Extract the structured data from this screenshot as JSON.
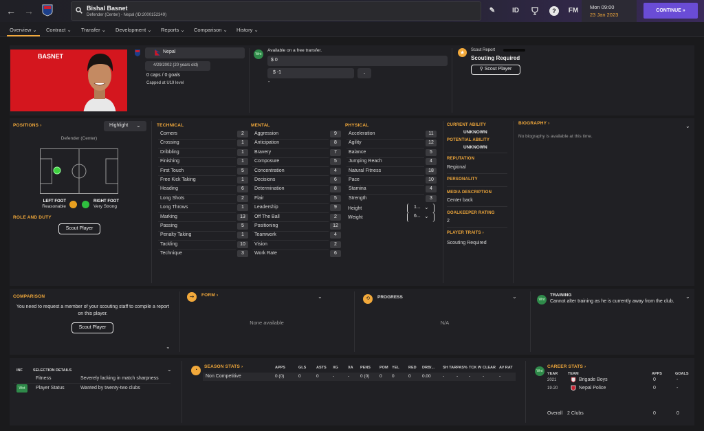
{
  "topbar": {
    "player_name": "Bishal Basnet",
    "player_sub": "Defender (Center) - Nepal (ID:2000152349)",
    "tools": {
      "edit": "✎",
      "id": "ID",
      "fm": "FM",
      "help": "?"
    },
    "date_day": "Mon 09:00",
    "date": "23 Jan 2023",
    "continue_label": "CONTINUE"
  },
  "menu": [
    "Overview",
    "Contract",
    "Transfer",
    "Development",
    "Reports",
    "Comparison",
    "History"
  ],
  "header": {
    "surname": "BASNET",
    "nation": "Nepal",
    "dob": "4/29/2002 (20 years old)",
    "caps": "0 caps / 0 goals",
    "capped": "Capped at U19 level",
    "transfer_status": "Available on a free transfer.",
    "value": "$ 0",
    "wage": "$ -1",
    "wage_dash": "-",
    "extra": "-",
    "scout_report_label": "Scout Report",
    "scouting_required": "Scouting Required",
    "scout_button": "Scout Player",
    "wnt_badge": "Wnt"
  },
  "positions": {
    "title": "POSITIONS",
    "highlight": "Highlight",
    "position": "Defender (Center)",
    "left_foot_label": "LEFT FOOT",
    "left_foot": "Reasonable",
    "right_foot_label": "RIGHT FOOT",
    "right_foot": "Very Strong",
    "role_title": "ROLE AND DUTY",
    "scout_button": "Scout Player"
  },
  "technical": {
    "title": "TECHNICAL",
    "items": [
      {
        "l": "Corners",
        "v": "2"
      },
      {
        "l": "Crossing",
        "v": "1"
      },
      {
        "l": "Dribbling",
        "v": "1"
      },
      {
        "l": "Finishing",
        "v": "1"
      },
      {
        "l": "First Touch",
        "v": "5"
      },
      {
        "l": "Free Kick Taking",
        "v": "1"
      },
      {
        "l": "Heading",
        "v": "6"
      },
      {
        "l": "Long Shots",
        "v": "2"
      },
      {
        "l": "Long Throws",
        "v": "1"
      },
      {
        "l": "Marking",
        "v": "13"
      },
      {
        "l": "Passing",
        "v": "5"
      },
      {
        "l": "Penalty Taking",
        "v": "1"
      },
      {
        "l": "Tackling",
        "v": "10"
      },
      {
        "l": "Technique",
        "v": "3"
      }
    ]
  },
  "mental": {
    "title": "MENTAL",
    "items": [
      {
        "l": "Aggression",
        "v": "9"
      },
      {
        "l": "Anticipation",
        "v": "8"
      },
      {
        "l": "Bravery",
        "v": "7"
      },
      {
        "l": "Composure",
        "v": "5"
      },
      {
        "l": "Concentration",
        "v": "4"
      },
      {
        "l": "Decisions",
        "v": "6"
      },
      {
        "l": "Determination",
        "v": "8"
      },
      {
        "l": "Flair",
        "v": "5"
      },
      {
        "l": "Leadership",
        "v": "9"
      },
      {
        "l": "Off The Ball",
        "v": "2"
      },
      {
        "l": "Positioning",
        "v": "12"
      },
      {
        "l": "Teamwork",
        "v": "4"
      },
      {
        "l": "Vision",
        "v": "2"
      },
      {
        "l": "Work Rate",
        "v": "6"
      }
    ]
  },
  "physical": {
    "title": "PHYSICAL",
    "items": [
      {
        "l": "Acceleration",
        "v": "11"
      },
      {
        "l": "Agility",
        "v": "12"
      },
      {
        "l": "Balance",
        "v": "5"
      },
      {
        "l": "Jumping Reach",
        "v": "4"
      },
      {
        "l": "Natural Fitness",
        "v": "18"
      },
      {
        "l": "Pace",
        "v": "10"
      },
      {
        "l": "Stamina",
        "v": "4"
      },
      {
        "l": "Strength",
        "v": "3"
      }
    ],
    "height_label": "Height",
    "height": "1...",
    "weight_label": "Weight",
    "weight": "6..."
  },
  "info": {
    "current_ability_label": "CURRENT ABILITY",
    "current_ability": "UNKNOWN",
    "potential_ability_label": "POTENTIAL ABILITY",
    "potential_ability": "UNKNOWN",
    "reputation_label": "REPUTATION",
    "reputation": "Regional",
    "personality_label": "PERSONALITY",
    "media_label": "MEDIA DESCRIPTION",
    "media": "Center back",
    "gk_label": "GOALKEEPER RATING",
    "gk": "2",
    "traits_label": "PLAYER TRAITS",
    "traits": "Scouting Required"
  },
  "biography": {
    "title": "BIOGRAPHY",
    "text": "No biography is available at this time."
  },
  "comparison": {
    "title": "COMPARISON",
    "text": "You need to request a member of your scouting staff to compile a report on this player.",
    "button": "Scout Player"
  },
  "form": {
    "title": "FORM",
    "text": "None available"
  },
  "progress": {
    "title": "PROGRESS",
    "text": "N/A"
  },
  "training": {
    "title": "TRAINING",
    "text": "Cannot alter training as he is currently away from the club.",
    "badge": "Wnt"
  },
  "inf": {
    "col1": "INF",
    "col2": "SELECTION DETAILS",
    "rows": [
      {
        "inf": "",
        "label": "Fitness",
        "detail": "Severely lacking in match sharpness"
      },
      {
        "inf": "Wnt",
        "label": "Player Status",
        "detail": "Wanted by twenty-two clubs"
      }
    ]
  },
  "season": {
    "title": "SEASON STATS",
    "headers": [
      "APPS",
      "GLS",
      "ASTS",
      "XG",
      "XA",
      "PENS",
      "POM",
      "YEL",
      "RED",
      "DRB/...",
      "SH TAR",
      "PAS%",
      "TCK W",
      "CLEAR",
      "AV RAT"
    ],
    "row_label": "Non Competitive",
    "row": [
      "0 (0)",
      "0",
      "0",
      "-",
      "-",
      "0 (0)",
      "0",
      "0",
      "0",
      "0.00",
      "-",
      "-",
      "-",
      "-",
      "-"
    ]
  },
  "career": {
    "title": "CAREER STATS",
    "col_year": "YEAR",
    "col_team": "TEAM",
    "col_apps": "APPS",
    "col_goals": "GOALS",
    "badge": "Wnt",
    "rows": [
      {
        "year": "2021",
        "team": "Brigade Boys",
        "apps": "0",
        "goals": "-"
      },
      {
        "year": "19-20",
        "team": "Nepal Police",
        "apps": "0",
        "goals": "-"
      }
    ],
    "overall_label": "Overall",
    "overall_clubs": "2 Clubs",
    "overall_apps": "0",
    "overall_goals": "0"
  },
  "colors": {
    "accent": "#f2a93b",
    "continue": "#6a4cd6",
    "pitch_dot": "#3fd13f",
    "banner": "#d4161e"
  }
}
